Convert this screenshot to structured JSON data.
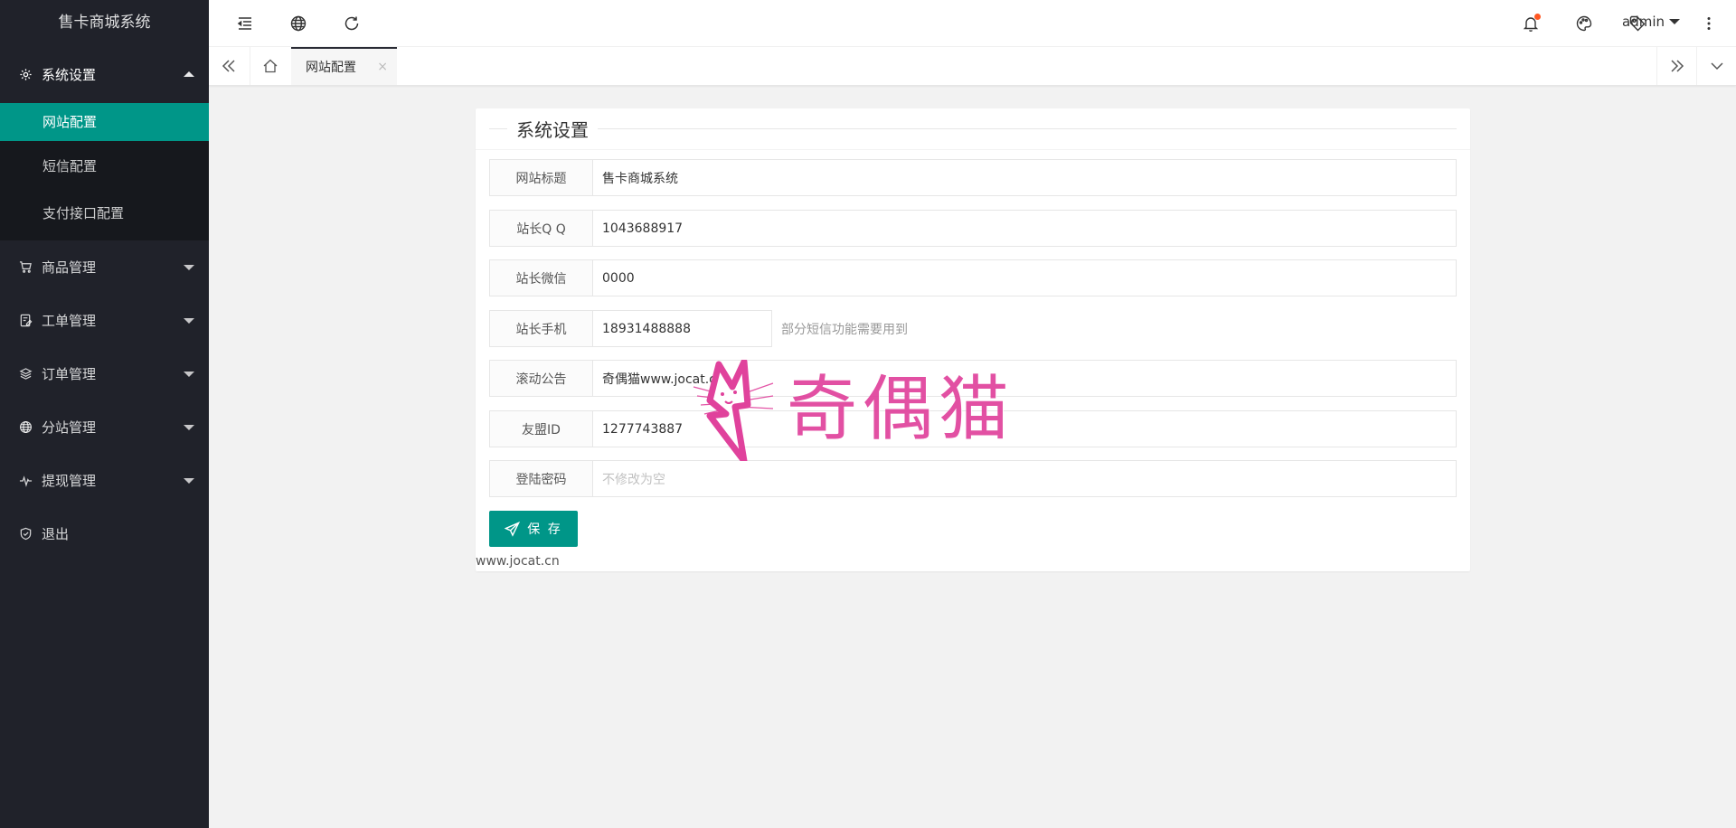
{
  "sidebar": {
    "logo": "售卡商城系统",
    "system_settings": {
      "label": "系统设置",
      "sub": [
        {
          "label": "网站配置",
          "active": true
        },
        {
          "label": "短信配置"
        },
        {
          "label": "支付接口配置"
        }
      ]
    },
    "items": [
      {
        "label": "商品管理",
        "icon": "cart-icon"
      },
      {
        "label": "工单管理",
        "icon": "ticket-icon"
      },
      {
        "label": "订单管理",
        "icon": "layers-icon"
      },
      {
        "label": "分站管理",
        "icon": "globe-icon"
      },
      {
        "label": "提现管理",
        "icon": "pulse-icon"
      },
      {
        "label": "退出",
        "icon": "shield-icon"
      }
    ]
  },
  "header": {
    "user": "admin",
    "notification_badge_color": "#ff5722"
  },
  "tabs": {
    "active_tab": "网站配置",
    "close_glyph": "×"
  },
  "form": {
    "legend": "系统设置",
    "fields": [
      {
        "label": "网站标题",
        "value": "售卡商城系统"
      },
      {
        "label": "站长Q Q",
        "value": "1043688917"
      },
      {
        "label": "站长微信",
        "value": "0000"
      },
      {
        "label": "站长手机",
        "value": "18931488888",
        "hint": "部分短信功能需要用到"
      },
      {
        "label": "滚动公告",
        "value": "奇偶猫www.jocat.cn"
      },
      {
        "label": "友盟ID",
        "value": "1277743887"
      },
      {
        "label": "登陆密码",
        "value": "",
        "placeholder": "不修改为空"
      }
    ],
    "save_label": "保 存",
    "footer": "www.jocat.cn"
  },
  "watermark": {
    "text": "奇偶猫",
    "color": "#e0429c"
  },
  "theme": {
    "accent": "#009688",
    "sidebar_bg": "#20222a"
  }
}
